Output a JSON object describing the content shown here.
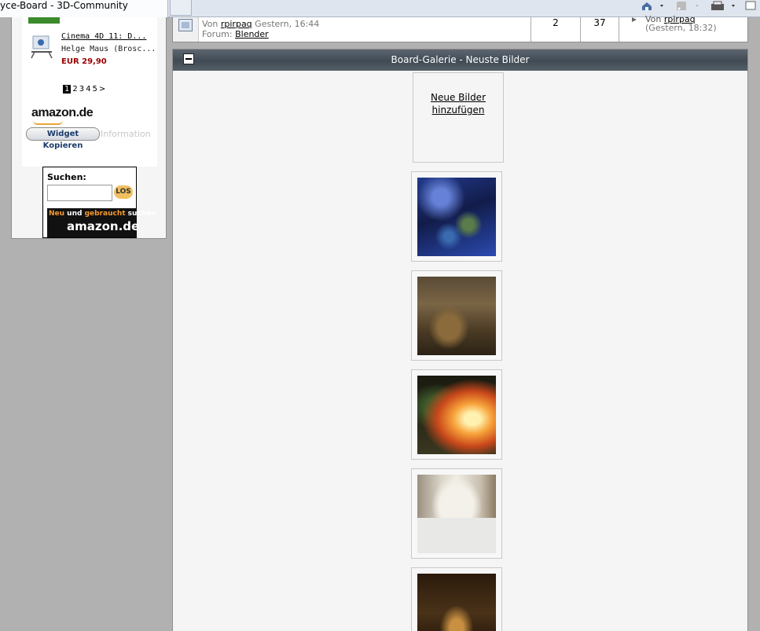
{
  "browser": {
    "tab_title": "yce-Board - 3D-Community"
  },
  "sidebar": {
    "product": {
      "title": "Cinema 4D 11: D...",
      "author": "Helge Maus (Brosc...",
      "price": "EUR 29,90"
    },
    "pager": {
      "current": "1",
      "pages": [
        "2",
        "3",
        "4",
        "5"
      ],
      "next": ">"
    },
    "amazon_logo": "amazon.de",
    "widget_button": "Widget Kopieren",
    "widget_info": "Information",
    "search": {
      "label": "Suchen:",
      "placeholder": "",
      "go_button": "LOS",
      "banner_top_orange1": "Neu",
      "banner_top_mid": " und ",
      "banner_top_orange2": "gebraucht",
      "banner_top_end": " suchen",
      "banner_logo": "amazon.de"
    }
  },
  "thread": {
    "by_prefix": "Von",
    "author": "rpirpaq",
    "date": "Gestern, 16:44",
    "forum_prefix": "Forum:",
    "forum": "Blender",
    "replies": "2",
    "views": "37",
    "last_by_prefix": "Von",
    "last_author": "rpirpaq",
    "last_date": "(Gestern, 18:32)"
  },
  "gallery": {
    "title": "Board-Galerie - Neuste Bilder",
    "add_link_line1": "Neue Bilder",
    "add_link_line2": "hinzufügen",
    "images": [
      "forest-night-scene",
      "vintage-car-street",
      "fire-breathing-dragon",
      "snowy-town-house",
      "dark-interior"
    ]
  }
}
